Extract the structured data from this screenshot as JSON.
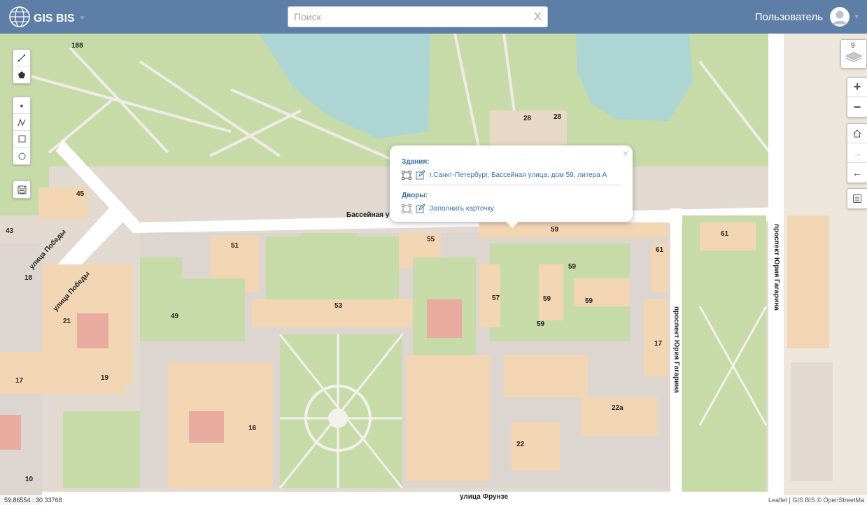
{
  "app": {
    "title": "GIS BIS"
  },
  "search": {
    "placeholder": "Поиск",
    "clear": "X"
  },
  "user": {
    "name": "Пользователь"
  },
  "layers": {
    "count": "9"
  },
  "popup": {
    "buildings_title": "Здания:",
    "building_address": "г.Санкт-Петербург, Бассейная улица, дом 59, литера А",
    "yards_title": "Дворы:",
    "yard_action": "Заполнить карточку",
    "close": "×"
  },
  "streets": {
    "basseynaya": "Бассейная у",
    "pobedy_1": "улица Победы",
    "pobedy_2": "улица Победы",
    "gagarina_1": "проспект Юрия Гагарина",
    "gagarina_2": "проспект Юрия Гагарина",
    "frunze": "улица Фрунзе"
  },
  "buildings": {
    "b188": "188",
    "b28a": "28",
    "b28b": "28",
    "b45": "45",
    "b43": "43",
    "b18": "18",
    "b21": "21",
    "b51": "51",
    "b55": "55",
    "b59a": "59",
    "b61a": "61",
    "b61b": "61",
    "b59b": "59",
    "b57": "57",
    "b59c": "59",
    "b59d": "59",
    "b59e": "59",
    "b53": "53",
    "b49": "49",
    "b17a": "17",
    "b17b": "17",
    "b19": "19",
    "b16": "16",
    "b22a": "22а",
    "b22": "22",
    "b10": "10"
  },
  "status": {
    "coordinates": "59.86554 : 30.33768",
    "attribution": "Leaflet | GIS BIS © OpenStreetMa"
  }
}
